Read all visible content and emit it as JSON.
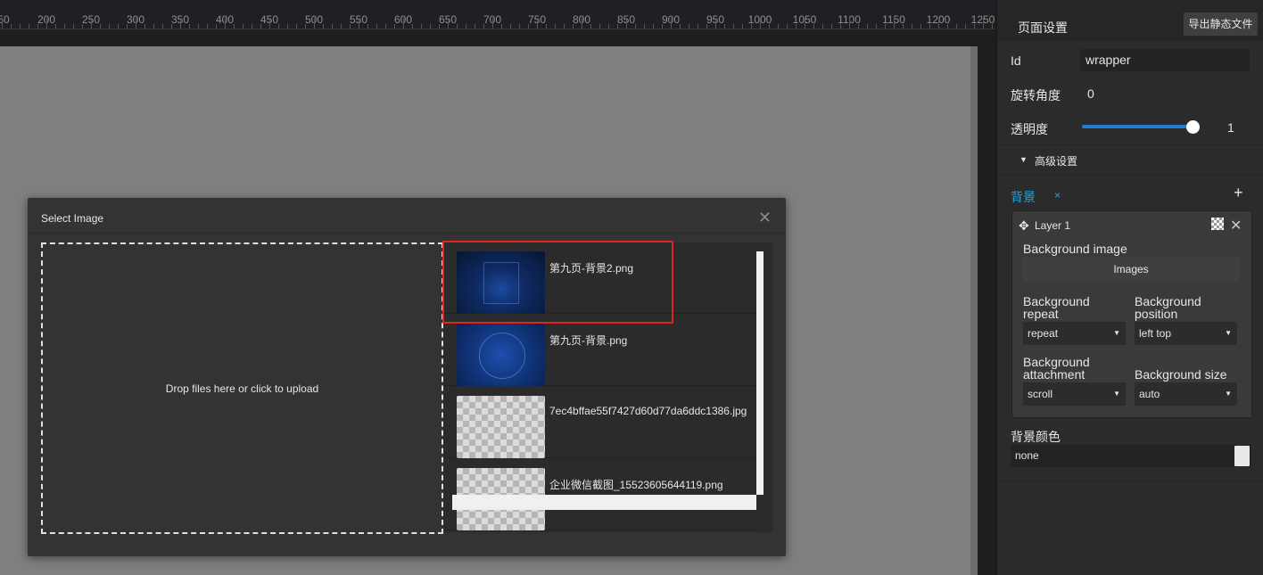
{
  "ruler": {
    "labels": [
      "50",
      "200",
      "250",
      "300",
      "350",
      "400",
      "450",
      "500",
      "550",
      "600",
      "650",
      "700",
      "750",
      "800",
      "850",
      "900",
      "950",
      "1000",
      "1050",
      "1100",
      "1150",
      "1200",
      "1250"
    ]
  },
  "modal": {
    "title": "Select Image",
    "close_icon": "close-icon",
    "dropzone_text": "Drop files here or click to upload",
    "files": [
      {
        "name": "第九页-背景2.png",
        "thumb": "blue-stage",
        "selected": true
      },
      {
        "name": "第九页-背景.png",
        "thumb": "blue-circle"
      },
      {
        "name": "7ec4bffae55f7427d60d77da6ddc1386.jpg",
        "thumb": "transparent"
      },
      {
        "name": "企业微信截图_15523605644119.png",
        "thumb": "transparent"
      }
    ]
  },
  "panel": {
    "title": "页面设置",
    "export_label": "导出静态文件",
    "id_label": "Id",
    "id_value": "wrapper",
    "rotate_label": "旋转角度",
    "rotate_value": "0",
    "opacity_label": "透明度",
    "opacity_value": "1",
    "advanced_label": "高级设置",
    "background_label": "背景",
    "background_remove": "×",
    "background_add": "+",
    "layer": {
      "name": "Layer 1",
      "bg_image_label": "Background image",
      "images_button": "Images",
      "repeat_label_1": "Background",
      "repeat_label_2": "repeat",
      "repeat_value": "repeat",
      "position_label_1": "Background",
      "position_label_2": "position",
      "position_value": "left top",
      "attachment_label_1": "Background",
      "attachment_label_2": "attachment",
      "attachment_value": "scroll",
      "size_label": "Background size",
      "size_value": "auto"
    },
    "bgcolor_label": "背景颜色",
    "bgcolor_value": "none"
  },
  "colors": {
    "accent": "#22a6d6",
    "slider": "#1e7ed6",
    "highlight": "#e3231f"
  }
}
